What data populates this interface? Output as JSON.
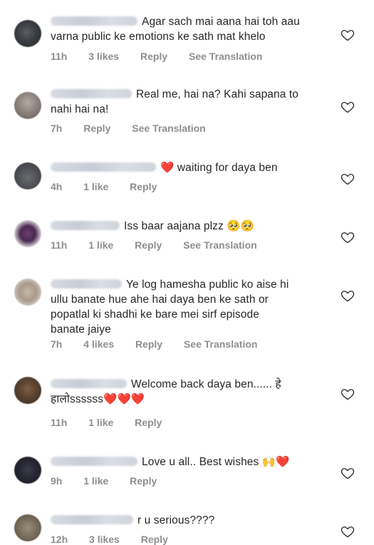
{
  "comments": [
    {
      "text_lines": [
        "Agar sach mai aana hai toh aau",
        "varna public ke emotions ke sath mat khelo"
      ],
      "time": "11h",
      "likes": "3 likes",
      "reply": "Reply",
      "translation": "See Translation"
    },
    {
      "text_lines": [
        "Real me, hai na? Kahi sapana to",
        "nahi hai na!"
      ],
      "time": "7h",
      "reply": "Reply",
      "translation": "See Translation"
    },
    {
      "text_lines": [
        "❤️ waiting for daya ben"
      ],
      "time": "4h",
      "likes": "1 like",
      "reply": "Reply"
    },
    {
      "text_lines": [
        "Iss baar aajana plzz 🥺🥺"
      ],
      "time": "11h",
      "likes": "1 like",
      "reply": "Reply",
      "translation": "See Translation"
    },
    {
      "text_lines": [
        "Ye log hamesha public ko aise hi",
        "ullu banate hue ahe hai daya ben ke sath or",
        "popatlal ki shadhi ke bare mei sirf episode",
        "banate jaiye"
      ],
      "time": "7h",
      "likes": "4 likes",
      "reply": "Reply",
      "translation": "See Translation"
    },
    {
      "text_lines": [
        "Welcome back daya ben...... हे",
        "हालोssssss❤️❤️❤️"
      ],
      "time": "11h",
      "likes": "1 like",
      "reply": "Reply"
    },
    {
      "text_lines": [
        "Love u all.. Best wishes 🙌❤️"
      ],
      "time": "9h",
      "likes": "1 like",
      "reply": "Reply"
    },
    {
      "text_lines": [
        "r u serious????"
      ],
      "time": "12h",
      "likes": "3 likes",
      "reply": "Reply"
    }
  ],
  "icons": {
    "like": "heart-outline-icon"
  }
}
